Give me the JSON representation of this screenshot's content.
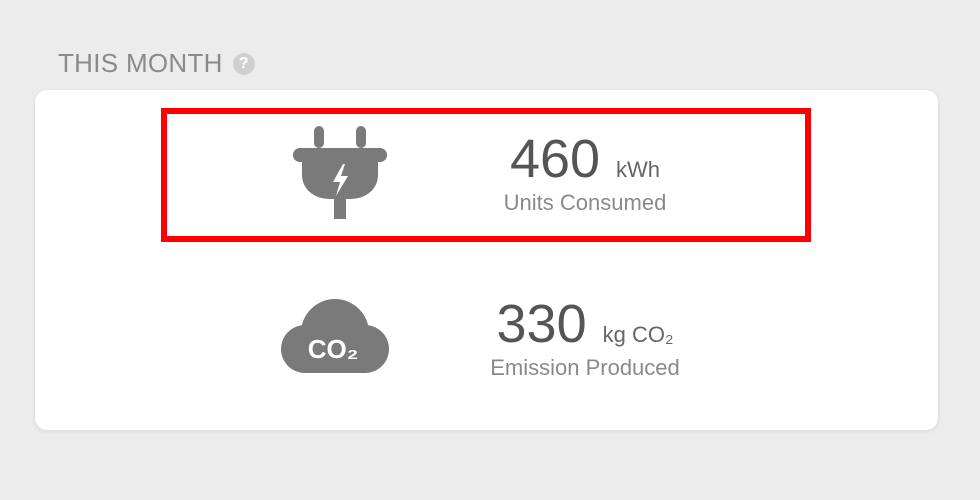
{
  "section": {
    "title": "THIS MONTH",
    "help_icon": "question-icon",
    "help_glyph": "?"
  },
  "stats": {
    "units": {
      "value": "460",
      "unit": "kWh",
      "label": "Units Consumed",
      "icon": "plug-icon"
    },
    "emission": {
      "value": "330",
      "unit": "kg CO₂",
      "label": "Emission Produced",
      "icon": "co2-cloud-icon",
      "icon_text": "CO₂"
    }
  },
  "colors": {
    "background": "#ececec",
    "card": "#ffffff",
    "icon": "#7a7a7a",
    "value": "#555555",
    "label": "#8a8a8a",
    "highlight": "#ff0000"
  }
}
